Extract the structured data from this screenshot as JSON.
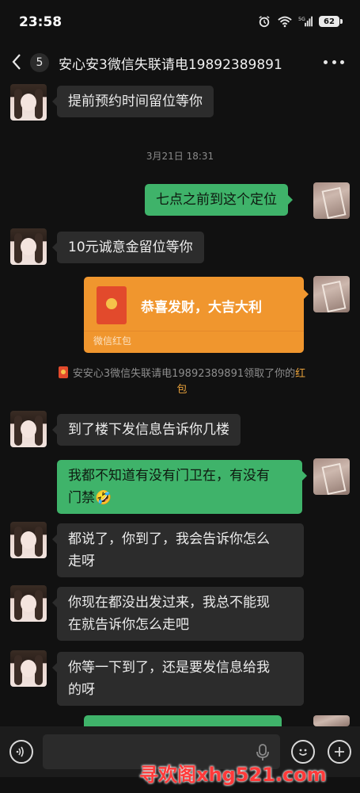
{
  "status_bar": {
    "time": "23:58",
    "network": "5G",
    "battery": "62"
  },
  "header": {
    "back_count": "5",
    "title": "安心安3微信失联请电19892389891"
  },
  "timestamp": "3月21日 18:31",
  "messages": [
    {
      "from": "contact",
      "text": "提前预约时间留位等你"
    },
    {
      "from": "me",
      "text": "七点之前到这个定位"
    },
    {
      "from": "contact",
      "text": "10元诚意金留位等你"
    },
    {
      "from": "contact",
      "text": "到了楼下发信息告诉你几楼"
    },
    {
      "from": "me",
      "line1": "我都不知道有没有门卫在，有没有",
      "line2": "门禁🤣"
    },
    {
      "from": "contact",
      "line1": "都说了，你到了，我会告诉你怎么",
      "line2": "走呀"
    },
    {
      "from": "contact",
      "line1": "你现在都没出发过来，我总不能现",
      "line2": "在就告诉你怎么走吧"
    },
    {
      "from": "contact",
      "line1": "你等一下到了，还是要发信息给我",
      "line2": "的呀"
    }
  ],
  "red_packet": {
    "text": "恭喜发财，大吉大利",
    "footer": "微信红包"
  },
  "system_note": {
    "text": "安安心3微信失联请电19892389891领取了你的",
    "link_part1": "红",
    "link_part2": "包"
  },
  "watermark": "寻欢阁xhg521.com",
  "colors": {
    "sent_bubble": "#3fb36a",
    "received_bubble": "#2c2c2c",
    "red_packet": "#f0962e",
    "background": "#111111"
  }
}
